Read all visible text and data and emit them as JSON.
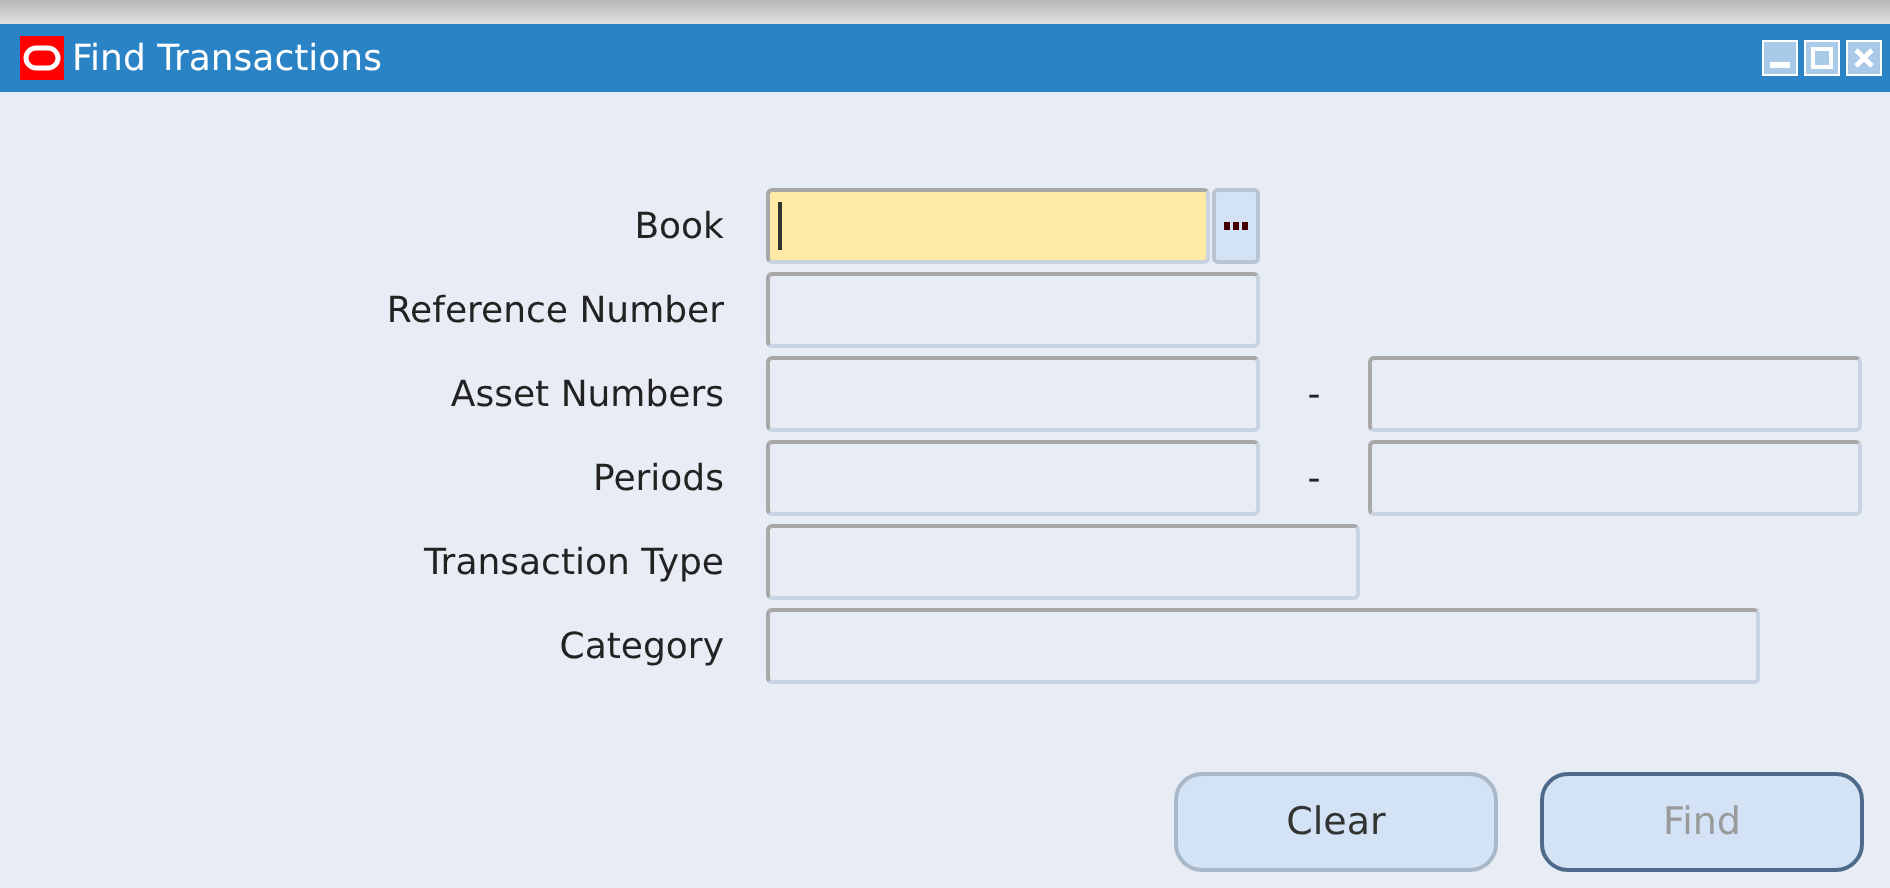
{
  "window": {
    "title": "Find Transactions"
  },
  "fields": [
    {
      "label": "Book",
      "kind": "lov",
      "focused": true
    },
    {
      "label": "Reference Number",
      "kind": "single",
      "focused": false
    },
    {
      "label": "Asset Numbers",
      "kind": "range",
      "focused": false,
      "separator": "-"
    },
    {
      "label": "Periods",
      "kind": "range",
      "focused": false,
      "separator": "-"
    },
    {
      "label": "Transaction Type",
      "kind": "single",
      "focused": false
    },
    {
      "label": "Category",
      "kind": "single",
      "focused": false
    }
  ],
  "buttons": [
    {
      "label": "Clear",
      "disabled": false
    },
    {
      "label": "Find",
      "disabled": true
    }
  ]
}
